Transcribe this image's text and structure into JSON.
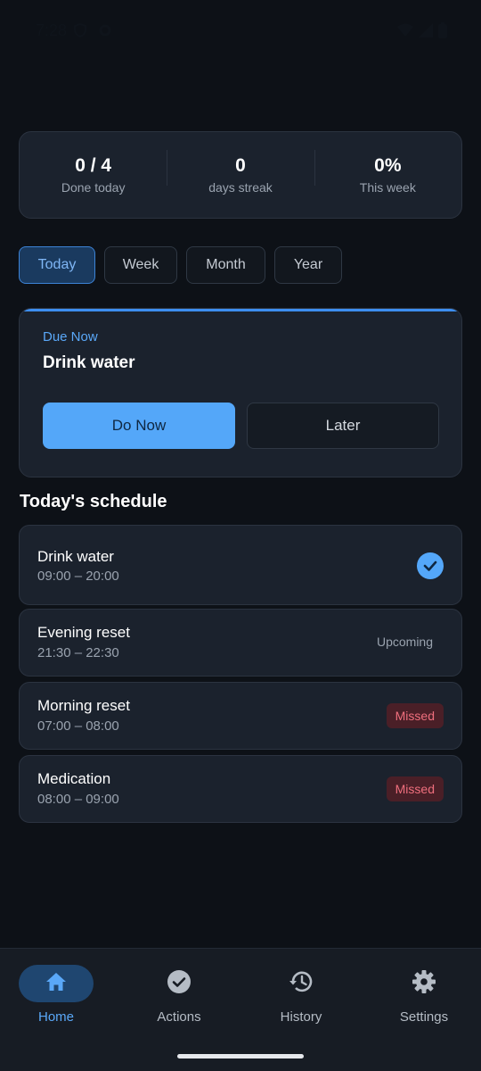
{
  "status_bar": {
    "time": "7:28"
  },
  "stats": [
    {
      "value": "0 / 4",
      "label": "Done today"
    },
    {
      "value": "0",
      "label": "days streak"
    },
    {
      "value": "0%",
      "label": "This week"
    }
  ],
  "tabs": [
    {
      "label": "Today",
      "active": true
    },
    {
      "label": "Week",
      "active": false
    },
    {
      "label": "Month",
      "active": false
    },
    {
      "label": "Year",
      "active": false
    }
  ],
  "due": {
    "label": "Due Now",
    "title": "Drink water",
    "do_now": "Do Now",
    "later": "Later"
  },
  "schedule": {
    "title": "Today's schedule",
    "items": [
      {
        "name": "Drink water",
        "time": "09:00 – 20:00",
        "status": "done"
      },
      {
        "name": "Evening reset",
        "time": "21:30 – 22:30",
        "status": "Upcoming"
      },
      {
        "name": "Morning reset",
        "time": "07:00 – 08:00",
        "status": "Missed"
      },
      {
        "name": "Medication",
        "time": "08:00 – 09:00",
        "status": "Missed"
      }
    ]
  },
  "nav": [
    {
      "label": "Home",
      "icon": "home-icon",
      "active": true
    },
    {
      "label": "Actions",
      "icon": "check-circle-icon",
      "active": false
    },
    {
      "label": "History",
      "icon": "history-icon",
      "active": false
    },
    {
      "label": "Settings",
      "icon": "gear-icon",
      "active": false
    }
  ],
  "colors": {
    "background": "#0d1117",
    "card": "#1b222d",
    "accent": "#54a7f9",
    "missed": "#ef6f7d"
  }
}
